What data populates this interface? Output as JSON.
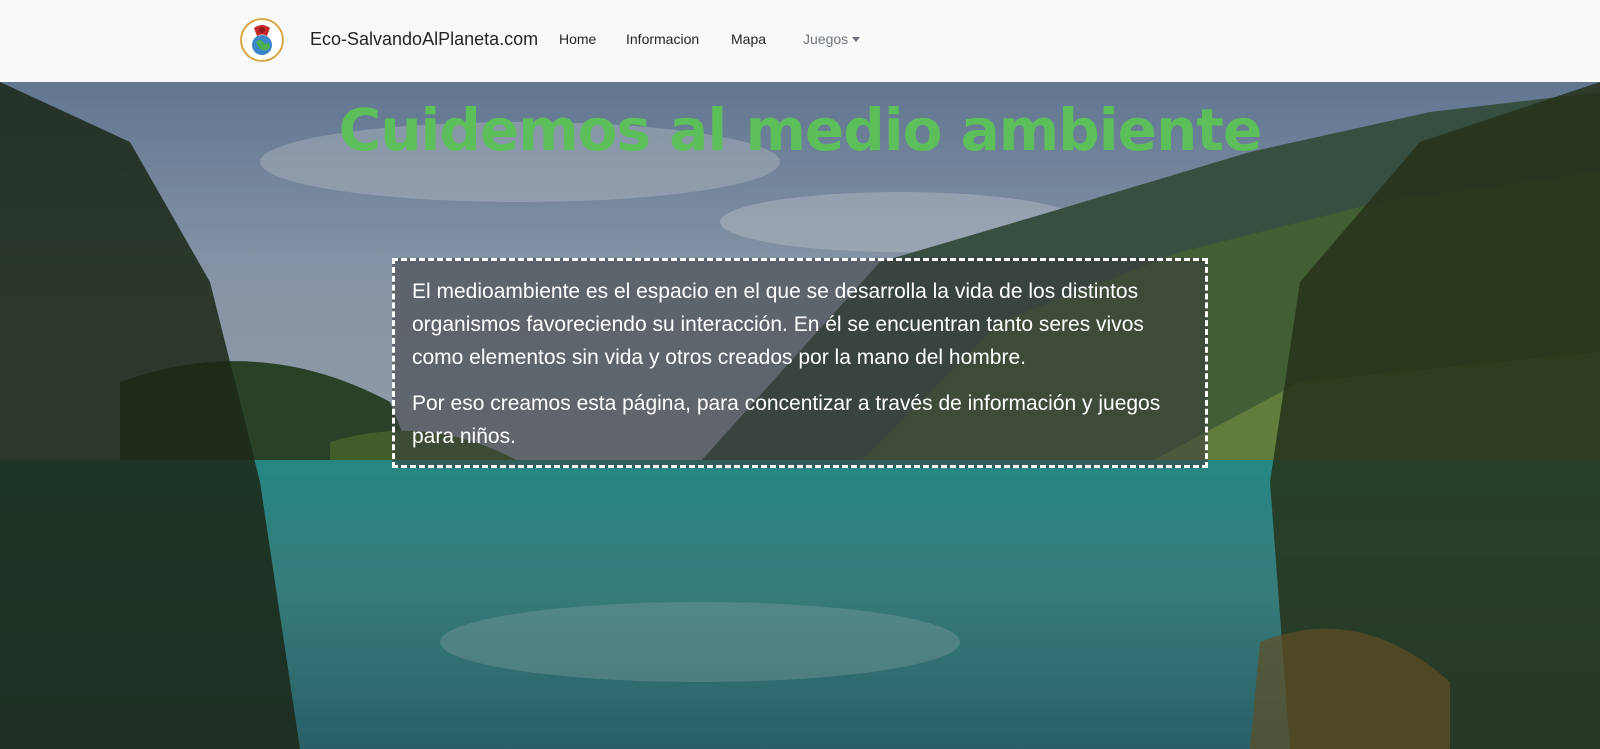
{
  "navbar": {
    "brand": "Eco-SalvandoAlPlaneta.com",
    "links": [
      {
        "label": "Home"
      },
      {
        "label": "Informacion"
      },
      {
        "label": "Mapa"
      },
      {
        "label": "Juegos",
        "icon": "caret-down-icon"
      }
    ]
  },
  "hero": {
    "title": "Cuidemos al medio ambiente",
    "paragraphs": [
      "El medioambiente es el espacio en el que se desarrolla la vida de los distintos organismos favoreciendo su interacción. En él se encuentran tanto seres vivos como elementos sin vida y otros creados por la mano del hombre.",
      "Por eso creamos esta página, para concentizar a través de información y juegos para niños."
    ]
  },
  "colors": {
    "title_green": "#5cbf5a",
    "navbar_bg": "#f8f9fa",
    "nav_text": "#212529",
    "dropdown_text": "#6c757d"
  }
}
